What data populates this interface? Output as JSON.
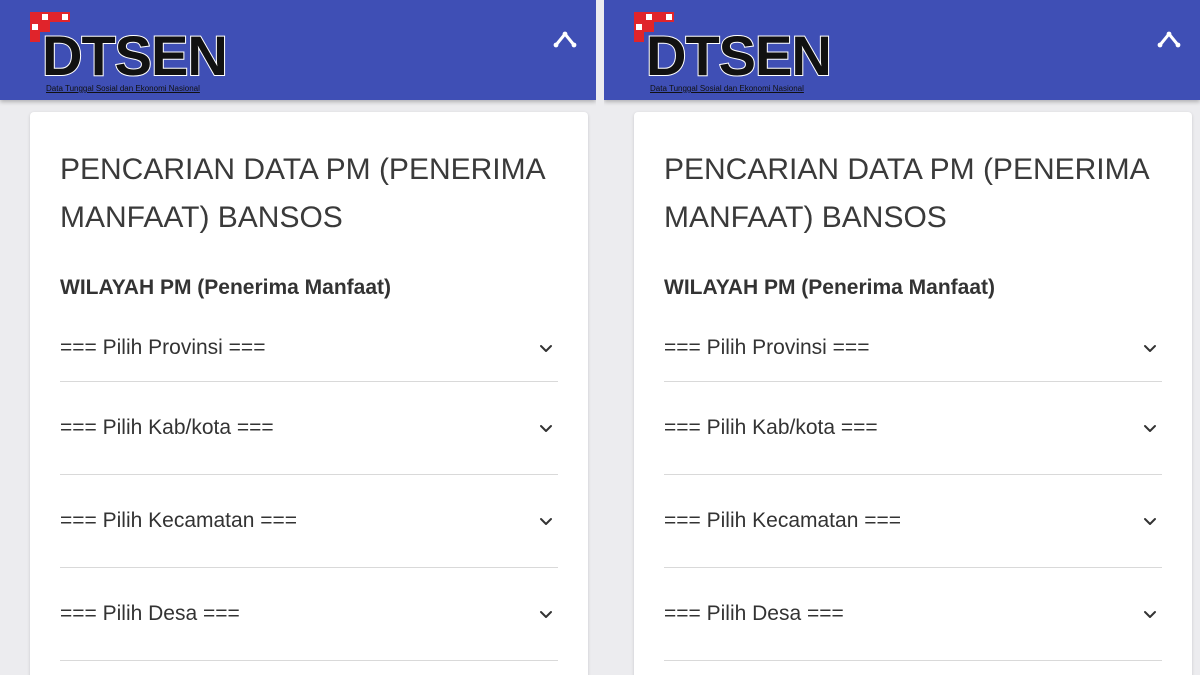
{
  "header": {
    "logo_text": "DTSEN",
    "logo_subtitle": "Data Tunggal Sosial dan Ekonomi Nasional",
    "brand_color": "#3f4fb5",
    "logo_accent": "#e0242b",
    "collapse_icon": "chevron-up-icon"
  },
  "form": {
    "title": "PENCARIAN DATA PM (PENERIMA MANFAAT) BANSOS",
    "section_label": "WILAYAH PM (Penerima Manfaat)",
    "selects": [
      {
        "value": "=== Pilih Provinsi ==="
      },
      {
        "value": "=== Pilih Kab/kota ==="
      },
      {
        "value": "=== Pilih Kecamatan ==="
      },
      {
        "value": "=== Pilih Desa ==="
      }
    ]
  }
}
